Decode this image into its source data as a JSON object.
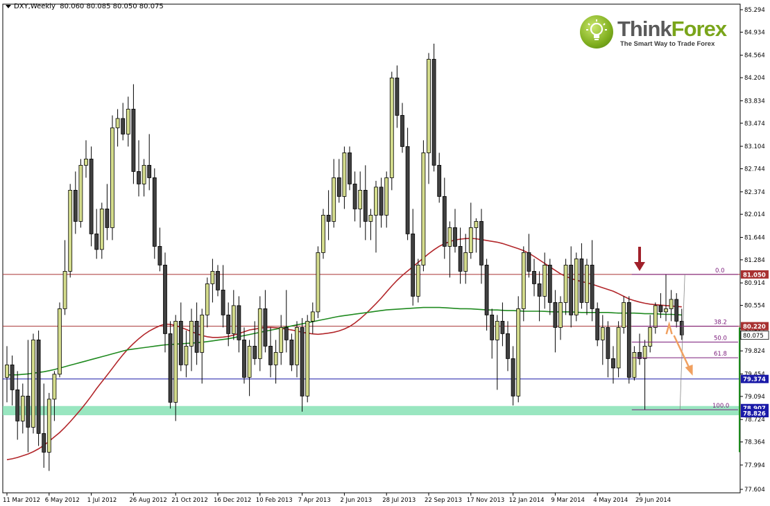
{
  "header": {
    "symbol": "DXY,Weekly",
    "ohlc": "80.060 80.085 80.050 80.075"
  },
  "logo": {
    "brand_part1": "Think",
    "brand_part2": "Forex",
    "tagline": "The Smart Way to Trade Forex",
    "icon": "lightbulb-icon"
  },
  "colors": {
    "bull_candle": "#d4dc8c",
    "bear_candle": "#404040",
    "ma_red": "#b2262a",
    "ma_green": "#1f8a1f",
    "hline_red": "#a83232",
    "hline_blue": "#1a1aa8",
    "support_zone": "#7fe0b0",
    "fib": "#7a1a7a",
    "arrow_down": "#a0202a",
    "arrow_orange": "#f0a060"
  },
  "chart_data": {
    "type": "candlestick",
    "y_axis": {
      "min": 77.604,
      "max": 85.294,
      "ticks": [
        "85.294",
        "84.934",
        "84.564",
        "84.204",
        "83.834",
        "83.474",
        "83.104",
        "82.744",
        "82.374",
        "82.014",
        "81.644",
        "81.284",
        "80.914",
        "80.554",
        "80.184",
        "79.824",
        "79.454",
        "79.094",
        "78.724",
        "78.364",
        "77.994",
        "77.604"
      ]
    },
    "x_axis": {
      "labels": [
        {
          "i": 0,
          "label": "11 Mar 2012"
        },
        {
          "i": 8,
          "label": "6 May 2012"
        },
        {
          "i": 16,
          "label": "1 Jul 2012"
        },
        {
          "i": 24,
          "label": "26 Aug 2012"
        },
        {
          "i": 32,
          "label": "21 Oct 2012"
        },
        {
          "i": 40,
          "label": "16 Dec 2012"
        },
        {
          "i": 48,
          "label": "10 Feb 2013"
        },
        {
          "i": 56,
          "label": "7 Apr 2013"
        },
        {
          "i": 64,
          "label": "2 Jun 2013"
        },
        {
          "i": 72,
          "label": "28 Jul 2013"
        },
        {
          "i": 80,
          "label": "22 Sep 2013"
        },
        {
          "i": 88,
          "label": "17 Nov 2013"
        },
        {
          "i": 96,
          "label": "12 Jan 2014"
        },
        {
          "i": 104,
          "label": "9 Mar 2014"
        },
        {
          "i": 112,
          "label": "4 May 2014"
        },
        {
          "i": 120,
          "label": "29 Jun 2014"
        }
      ]
    },
    "horizontal_lines": [
      {
        "name": "resistance",
        "value": 81.05,
        "label": "81.050",
        "color": "#a83232"
      },
      {
        "name": "fib-38",
        "value": 80.22,
        "label": "80.220",
        "color": "#a83232"
      },
      {
        "name": "support",
        "value": 79.374,
        "label": "79.374",
        "color": "#1a1aa8"
      }
    ],
    "support_zone": {
      "from": 78.826,
      "to": 78.907,
      "labels": [
        "78.907",
        "78.826"
      ]
    },
    "current_price": {
      "value": 80.075,
      "label": "80.075"
    },
    "fibonacci": {
      "start_index": 118,
      "end_index": 127,
      "levels": [
        {
          "label": "0.0",
          "value": 81.05
        },
        {
          "label": "38.2",
          "value": 80.22
        },
        {
          "label": "50.0",
          "value": 79.966
        },
        {
          "label": "61.8",
          "value": 79.714
        },
        {
          "label": "100.0",
          "value": 78.88
        }
      ]
    },
    "candles": [
      [
        79.4,
        79.9,
        79.0,
        79.6
      ],
      [
        79.6,
        79.75,
        78.95,
        79.2
      ],
      [
        79.2,
        79.5,
        78.4,
        78.7
      ],
      [
        78.7,
        79.3,
        78.5,
        79.1
      ],
      [
        79.1,
        80.0,
        78.2,
        78.6
      ],
      [
        78.6,
        80.1,
        78.5,
        80.0
      ],
      [
        80.0,
        80.15,
        78.3,
        78.5
      ],
      [
        78.5,
        79.3,
        77.95,
        78.2
      ],
      [
        78.2,
        79.15,
        77.9,
        79.05
      ],
      [
        79.05,
        79.5,
        78.7,
        79.45
      ],
      [
        79.45,
        80.6,
        79.4,
        80.5
      ],
      [
        80.5,
        81.6,
        80.4,
        81.1
      ],
      [
        81.1,
        82.5,
        81.0,
        82.4
      ],
      [
        82.4,
        82.7,
        81.7,
        81.9
      ],
      [
        81.9,
        82.9,
        81.8,
        82.8
      ],
      [
        82.8,
        83.2,
        82.6,
        82.9
      ],
      [
        82.9,
        83.1,
        81.5,
        81.7
      ],
      [
        81.7,
        82.1,
        81.3,
        81.45
      ],
      [
        81.45,
        82.2,
        81.3,
        82.1
      ],
      [
        82.1,
        82.5,
        81.6,
        81.8
      ],
      [
        81.8,
        83.6,
        81.6,
        83.4
      ],
      [
        83.4,
        83.7,
        83.1,
        83.55
      ],
      [
        83.55,
        83.8,
        83.2,
        83.3
      ],
      [
        83.3,
        83.9,
        83.1,
        83.7
      ],
      [
        83.7,
        84.1,
        82.5,
        82.7
      ],
      [
        82.7,
        83.2,
        82.3,
        82.5
      ],
      [
        82.5,
        82.9,
        82.3,
        82.8
      ],
      [
        82.8,
        83.3,
        82.4,
        82.6
      ],
      [
        82.6,
        82.75,
        81.3,
        81.5
      ],
      [
        81.5,
        81.8,
        81.1,
        81.2
      ],
      [
        81.2,
        81.4,
        79.8,
        80.1
      ],
      [
        80.1,
        80.3,
        78.9,
        79.0
      ],
      [
        79.0,
        80.4,
        78.7,
        80.3
      ],
      [
        80.3,
        80.6,
        79.5,
        79.6
      ],
      [
        79.6,
        80.15,
        79.4,
        79.9
      ],
      [
        79.9,
        80.5,
        79.5,
        80.3
      ],
      [
        80.3,
        80.6,
        79.6,
        79.8
      ],
      [
        79.8,
        80.5,
        79.3,
        80.4
      ],
      [
        80.4,
        81.0,
        80.2,
        80.9
      ],
      [
        80.9,
        81.3,
        80.6,
        81.1
      ],
      [
        81.1,
        81.2,
        80.7,
        80.8
      ],
      [
        80.8,
        81.2,
        80.2,
        80.4
      ],
      [
        80.4,
        80.6,
        79.9,
        80.1
      ],
      [
        80.1,
        80.8,
        80.0,
        80.55
      ],
      [
        80.55,
        80.7,
        79.8,
        80.0
      ],
      [
        80.0,
        80.2,
        79.3,
        79.4
      ],
      [
        79.4,
        80.0,
        79.1,
        79.9
      ],
      [
        79.9,
        80.3,
        79.6,
        79.7
      ],
      [
        79.7,
        80.7,
        79.5,
        80.5
      ],
      [
        80.5,
        80.8,
        79.8,
        79.9
      ],
      [
        79.9,
        80.2,
        79.4,
        79.6
      ],
      [
        79.6,
        80.0,
        79.3,
        79.8
      ],
      [
        79.8,
        80.4,
        79.6,
        80.2
      ],
      [
        80.2,
        80.8,
        79.8,
        80.0
      ],
      [
        80.0,
        80.1,
        79.5,
        79.6
      ],
      [
        79.6,
        80.3,
        79.4,
        80.2
      ],
      [
        80.2,
        80.35,
        78.85,
        79.1
      ],
      [
        79.1,
        80.4,
        79.0,
        80.3
      ],
      [
        80.3,
        80.6,
        80.1,
        80.45
      ],
      [
        80.45,
        81.5,
        80.35,
        81.4
      ],
      [
        81.4,
        82.1,
        81.3,
        82.0
      ],
      [
        82.0,
        82.4,
        81.6,
        81.9
      ],
      [
        81.9,
        82.9,
        81.8,
        82.6
      ],
      [
        82.6,
        82.9,
        82.2,
        82.3
      ],
      [
        82.3,
        83.1,
        82.1,
        83.0
      ],
      [
        83.0,
        83.1,
        82.4,
        82.5
      ],
      [
        82.5,
        82.7,
        81.9,
        82.1
      ],
      [
        82.1,
        82.7,
        81.8,
        82.4
      ],
      [
        82.4,
        82.8,
        81.6,
        81.9
      ],
      [
        81.9,
        82.1,
        81.6,
        82.0
      ],
      [
        82.0,
        82.55,
        81.4,
        82.45
      ],
      [
        82.45,
        82.6,
        81.8,
        82.0
      ],
      [
        82.0,
        82.7,
        81.8,
        82.6
      ],
      [
        82.6,
        84.3,
        82.4,
        84.2
      ],
      [
        84.2,
        84.4,
        83.4,
        83.6
      ],
      [
        83.6,
        83.8,
        83.0,
        83.1
      ],
      [
        83.1,
        83.4,
        81.6,
        81.7
      ],
      [
        81.7,
        82.1,
        80.55,
        80.7
      ],
      [
        80.7,
        81.3,
        80.6,
        81.2
      ],
      [
        81.2,
        83.2,
        81.1,
        83.0
      ],
      [
        83.0,
        84.6,
        82.5,
        84.5
      ],
      [
        84.5,
        84.75,
        82.7,
        82.8
      ],
      [
        82.8,
        83.0,
        82.2,
        82.3
      ],
      [
        82.3,
        82.6,
        81.3,
        81.5
      ],
      [
        81.5,
        81.9,
        81.0,
        81.8
      ],
      [
        81.8,
        82.1,
        81.4,
        81.5
      ],
      [
        81.5,
        81.8,
        80.9,
        81.1
      ],
      [
        81.1,
        81.7,
        80.9,
        81.4
      ],
      [
        81.4,
        82.2,
        81.3,
        81.8
      ],
      [
        81.8,
        81.95,
        81.4,
        81.9
      ],
      [
        81.9,
        82.1,
        80.9,
        81.2
      ],
      [
        81.2,
        81.3,
        80.15,
        80.4
      ],
      [
        80.4,
        80.5,
        79.7,
        80.0
      ],
      [
        80.0,
        80.4,
        79.2,
        80.3
      ],
      [
        80.3,
        80.6,
        79.9,
        80.1
      ],
      [
        80.1,
        80.3,
        79.5,
        79.7
      ],
      [
        79.7,
        79.9,
        78.95,
        79.1
      ],
      [
        79.1,
        80.7,
        79.0,
        80.5
      ],
      [
        80.5,
        81.5,
        80.3,
        81.4
      ],
      [
        81.4,
        81.7,
        81.0,
        81.1
      ],
      [
        81.1,
        81.3,
        80.7,
        80.9
      ],
      [
        80.9,
        81.1,
        80.3,
        80.7
      ],
      [
        80.7,
        81.4,
        80.5,
        81.2
      ],
      [
        81.2,
        81.3,
        80.4,
        80.6
      ],
      [
        80.6,
        80.8,
        79.8,
        80.2
      ],
      [
        80.2,
        80.7,
        80.0,
        80.6
      ],
      [
        80.6,
        81.3,
        80.4,
        81.2
      ],
      [
        81.2,
        81.5,
        80.2,
        80.4
      ],
      [
        80.4,
        81.4,
        80.3,
        81.3
      ],
      [
        81.3,
        81.55,
        80.5,
        80.6
      ],
      [
        80.6,
        81.3,
        80.4,
        81.2
      ],
      [
        81.2,
        81.6,
        80.3,
        80.5
      ],
      [
        80.5,
        80.6,
        79.9,
        80.0
      ],
      [
        80.0,
        80.4,
        79.6,
        80.2
      ],
      [
        80.2,
        80.3,
        79.4,
        79.7
      ],
      [
        79.7,
        79.9,
        79.3,
        79.55
      ],
      [
        79.55,
        80.3,
        79.4,
        80.2
      ],
      [
        80.2,
        80.7,
        80.1,
        80.6
      ],
      [
        80.6,
        80.7,
        79.3,
        79.4
      ],
      [
        79.4,
        79.9,
        79.35,
        79.8
      ],
      [
        79.8,
        80.1,
        79.6,
        79.7
      ],
      [
        79.7,
        80.0,
        78.88,
        79.9
      ],
      [
        79.9,
        80.4,
        79.8,
        80.2
      ],
      [
        80.2,
        80.6,
        80.1,
        80.55
      ],
      [
        80.55,
        80.75,
        80.35,
        80.45
      ],
      [
        80.45,
        81.05,
        80.3,
        80.5
      ],
      [
        80.5,
        80.8,
        80.3,
        80.65
      ],
      [
        80.65,
        80.75,
        80.2,
        80.3
      ],
      [
        80.3,
        80.5,
        80.0,
        80.08
      ]
    ],
    "ma_red": [
      78.08,
      78.1,
      78.14,
      78.18,
      78.24,
      78.32,
      78.42,
      78.52,
      78.64,
      78.78,
      78.92,
      79.08,
      79.25,
      79.4,
      79.56,
      79.72,
      79.86,
      79.98,
      80.08,
      80.16,
      80.22,
      80.26,
      80.24,
      80.2,
      80.15,
      80.1,
      80.06,
      80.04,
      80.04,
      80.05,
      80.08,
      80.12,
      80.16,
      80.18,
      80.2,
      80.2,
      80.19,
      80.17,
      80.15,
      80.12,
      80.1,
      80.09,
      80.1,
      80.12,
      80.15,
      80.2,
      80.28,
      80.38,
      80.5,
      80.62,
      80.76,
      80.9,
      81.02,
      81.12,
      81.22,
      81.32,
      81.42,
      81.5,
      81.56,
      81.6,
      81.62,
      81.63,
      81.62,
      81.6,
      81.58,
      81.56,
      81.52,
      81.48,
      81.44,
      81.38,
      81.3,
      81.22,
      81.14,
      81.06,
      81.0,
      80.96,
      80.93,
      80.9,
      80.86,
      80.82,
      80.78,
      80.72,
      80.66,
      80.62,
      80.59,
      80.57,
      80.56,
      80.55,
      80.54,
      80.53
    ],
    "ma_red_start": 0,
    "ma_green": [
      79.44,
      79.44,
      79.45,
      79.47,
      79.49,
      79.52,
      79.56,
      79.6,
      79.64,
      79.68,
      79.72,
      79.76,
      79.8,
      79.84,
      79.86,
      79.88,
      79.9,
      79.92,
      79.93,
      79.94,
      79.95,
      79.96,
      79.98,
      80.0,
      80.02,
      80.05,
      80.08,
      80.11,
      80.14,
      80.17,
      80.2,
      80.23,
      80.26,
      80.29,
      80.32,
      80.35,
      80.38,
      80.4,
      80.42,
      80.44,
      80.46,
      80.48,
      80.49,
      80.5,
      80.51,
      80.52,
      80.52,
      80.52,
      80.51,
      80.5,
      80.5,
      80.49,
      80.48,
      80.48,
      80.47,
      80.47,
      80.46,
      80.46,
      80.46,
      80.45,
      80.45,
      80.45,
      80.44,
      80.44,
      80.44,
      80.44,
      80.43,
      80.43,
      80.43,
      80.42,
      80.42,
      80.41,
      80.41,
      80.4
    ]
  }
}
